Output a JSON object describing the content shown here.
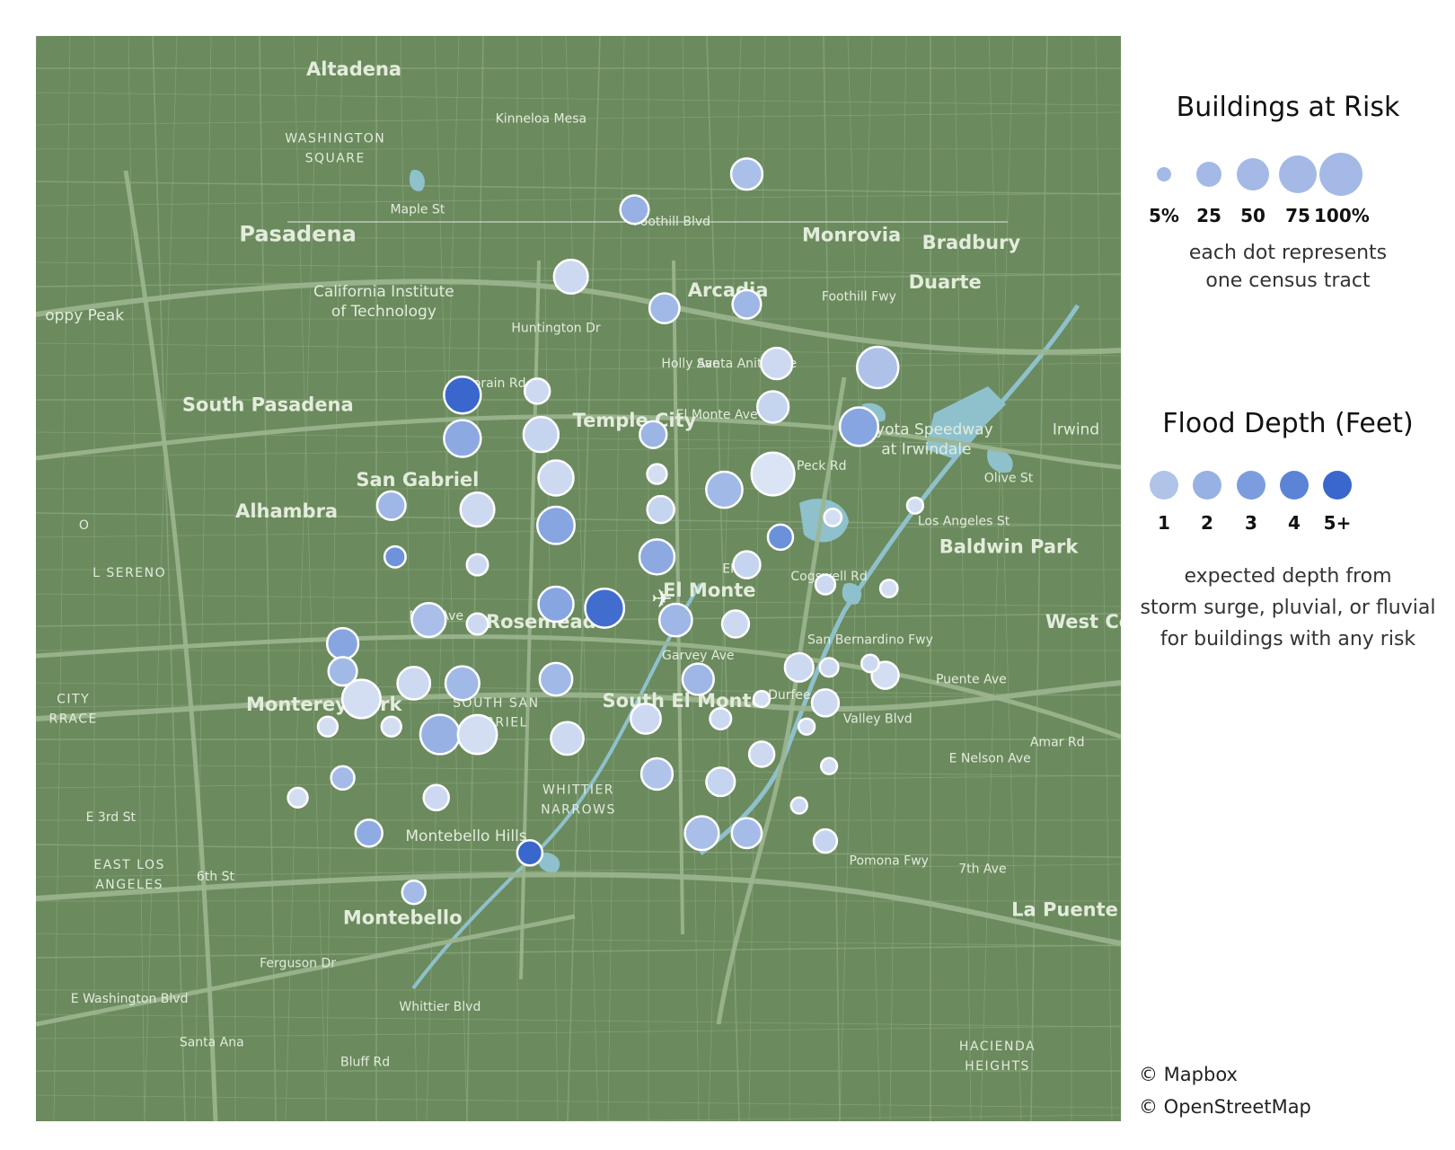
{
  "map": {
    "colors": {
      "land": "#6b8a5e",
      "road": "#8aa67d",
      "major_road": "#9cb58f",
      "water": "#8fc1cc",
      "label": "#e3ecdc",
      "dot_stroke": "#ffffff"
    },
    "places": [
      {
        "name": "Altadena",
        "lon": -118.135,
        "lat": 34.19,
        "size": "l"
      },
      {
        "name": "Kinneloa Mesa",
        "lon": -118.085,
        "lat": 34.178,
        "size": "s"
      },
      {
        "name": "WASHINGTON",
        "lon": -118.14,
        "lat": 34.173,
        "size": "caps"
      },
      {
        "name": "SQUARE",
        "lon": -118.14,
        "lat": 34.168,
        "size": "caps"
      },
      {
        "name": "Maple St",
        "lon": -118.118,
        "lat": 34.155,
        "size": "s"
      },
      {
        "name": "Foothill Blvd",
        "lon": -118.05,
        "lat": 34.152,
        "size": "s"
      },
      {
        "name": "Pasadena",
        "lon": -118.15,
        "lat": 34.148,
        "size": "xl"
      },
      {
        "name": "Monrovia",
        "lon": -118.002,
        "lat": 34.148,
        "size": "l"
      },
      {
        "name": "Bradbury",
        "lon": -117.97,
        "lat": 34.146,
        "size": "l"
      },
      {
        "name": "Duarte",
        "lon": -117.977,
        "lat": 34.136,
        "size": "l"
      },
      {
        "name": "Arcadia",
        "lon": -118.035,
        "lat": 34.134,
        "size": "l"
      },
      {
        "name": "Foothill Fwy",
        "lon": -118.0,
        "lat": 34.133,
        "size": "s"
      },
      {
        "name": "California Institute",
        "lon": -118.127,
        "lat": 34.134,
        "size": "m"
      },
      {
        "name": "of Technology",
        "lon": -118.127,
        "lat": 34.129,
        "size": "m"
      },
      {
        "name": "oppy Peak",
        "lon": -118.207,
        "lat": 34.128,
        "size": "m"
      },
      {
        "name": "Huntington Dr",
        "lon": -118.081,
        "lat": 34.125,
        "size": "s"
      },
      {
        "name": "Holly Ave",
        "lon": -118.045,
        "lat": 34.116,
        "size": "s"
      },
      {
        "name": "Santa Anita Ave",
        "lon": -118.03,
        "lat": 34.116,
        "size": "s"
      },
      {
        "name": "Lorain Rd",
        "lon": -118.097,
        "lat": 34.111,
        "size": "s"
      },
      {
        "name": "South Pasadena",
        "lon": -118.158,
        "lat": 34.105,
        "size": "l"
      },
      {
        "name": "El Monte Ave",
        "lon": -118.038,
        "lat": 34.103,
        "size": "s"
      },
      {
        "name": "Temple City",
        "lon": -118.06,
        "lat": 34.101,
        "size": "l"
      },
      {
        "name": "Toyota Speedway",
        "lon": -117.982,
        "lat": 34.099,
        "size": "m"
      },
      {
        "name": "at Irwindale",
        "lon": -117.982,
        "lat": 34.094,
        "size": "m"
      },
      {
        "name": "Irwind",
        "lon": -117.942,
        "lat": 34.099,
        "size": "m"
      },
      {
        "name": "Peck Rd",
        "lon": -118.01,
        "lat": 34.09,
        "size": "s"
      },
      {
        "name": "San Gabriel",
        "lon": -118.118,
        "lat": 34.086,
        "size": "l"
      },
      {
        "name": "Olive St",
        "lon": -117.96,
        "lat": 34.087,
        "size": "s"
      },
      {
        "name": "Alhambra",
        "lon": -118.153,
        "lat": 34.078,
        "size": "l"
      },
      {
        "name": "Los Angeles St",
        "lon": -117.972,
        "lat": 34.076,
        "size": "s"
      },
      {
        "name": "O",
        "lon": -118.207,
        "lat": 34.075,
        "size": "caps"
      },
      {
        "name": "Baldwin Park",
        "lon": -117.96,
        "lat": 34.069,
        "size": "l"
      },
      {
        "name": "EMT",
        "lon": -118.033,
        "lat": 34.064,
        "size": "s"
      },
      {
        "name": "L SERENO",
        "lon": -118.195,
        "lat": 34.063,
        "size": "caps"
      },
      {
        "name": "El Monte",
        "lon": -118.04,
        "lat": 34.058,
        "size": "l"
      },
      {
        "name": "Cogswell Rd",
        "lon": -118.008,
        "lat": 34.062,
        "size": "s"
      },
      {
        "name": "New Ave",
        "lon": -118.113,
        "lat": 34.052,
        "size": "s"
      },
      {
        "name": "Rosemead",
        "lon": -118.085,
        "lat": 34.05,
        "size": "l"
      },
      {
        "name": "West Cov",
        "lon": -117.937,
        "lat": 34.05,
        "size": "l"
      },
      {
        "name": "San Bernardino Fwy",
        "lon": -117.997,
        "lat": 34.046,
        "size": "s"
      },
      {
        "name": "Garvey Ave",
        "lon": -118.043,
        "lat": 34.042,
        "size": "s"
      },
      {
        "name": "Puente Ave",
        "lon": -117.97,
        "lat": 34.036,
        "size": "s"
      },
      {
        "name": "Durfee Ave",
        "lon": -118.015,
        "lat": 34.032,
        "size": "s"
      },
      {
        "name": "CITY",
        "lon": -118.21,
        "lat": 34.031,
        "size": "caps"
      },
      {
        "name": "RRACE",
        "lon": -118.21,
        "lat": 34.026,
        "size": "caps"
      },
      {
        "name": "Monterey Park",
        "lon": -118.143,
        "lat": 34.029,
        "size": "l"
      },
      {
        "name": "SOUTH SAN",
        "lon": -118.097,
        "lat": 34.03,
        "size": "caps"
      },
      {
        "name": "GABRIEL",
        "lon": -118.097,
        "lat": 34.025,
        "size": "caps"
      },
      {
        "name": "South El Monte",
        "lon": -118.047,
        "lat": 34.03,
        "size": "l"
      },
      {
        "name": "Valley Blvd",
        "lon": -117.995,
        "lat": 34.026,
        "size": "s"
      },
      {
        "name": "Amar Rd",
        "lon": -117.947,
        "lat": 34.02,
        "size": "s"
      },
      {
        "name": "E Nelson Ave",
        "lon": -117.965,
        "lat": 34.016,
        "size": "s"
      },
      {
        "name": "WHITTIER",
        "lon": -118.075,
        "lat": 34.008,
        "size": "caps"
      },
      {
        "name": "NARROWS",
        "lon": -118.075,
        "lat": 34.003,
        "size": "caps"
      },
      {
        "name": "E 3rd St",
        "lon": -118.2,
        "lat": 34.001,
        "size": "s"
      },
      {
        "name": "Montebello Hills",
        "lon": -118.105,
        "lat": 33.996,
        "size": "m"
      },
      {
        "name": "Pomona Fwy",
        "lon": -117.992,
        "lat": 33.99,
        "size": "s"
      },
      {
        "name": "7th Ave",
        "lon": -117.967,
        "lat": 33.988,
        "size": "s"
      },
      {
        "name": "EAST LOS",
        "lon": -118.195,
        "lat": 33.989,
        "size": "caps"
      },
      {
        "name": "ANGELES",
        "lon": -118.195,
        "lat": 33.984,
        "size": "caps"
      },
      {
        "name": "6th St",
        "lon": -118.172,
        "lat": 33.986,
        "size": "s"
      },
      {
        "name": "La Puente",
        "lon": -117.945,
        "lat": 33.977,
        "size": "l"
      },
      {
        "name": "Montebello",
        "lon": -118.122,
        "lat": 33.975,
        "size": "l"
      },
      {
        "name": "Ferguson Dr",
        "lon": -118.15,
        "lat": 33.964,
        "size": "s"
      },
      {
        "name": "E Washington Blvd",
        "lon": -118.195,
        "lat": 33.955,
        "size": "s"
      },
      {
        "name": "Whittier Blvd",
        "lon": -118.112,
        "lat": 33.953,
        "size": "s"
      },
      {
        "name": "Santa Ana",
        "lon": -118.173,
        "lat": 33.944,
        "size": "s"
      },
      {
        "name": "Bluff Rd",
        "lon": -118.132,
        "lat": 33.939,
        "size": "s"
      },
      {
        "name": "HACIENDA",
        "lon": -117.963,
        "lat": 33.943,
        "size": "caps"
      },
      {
        "name": "HEIGHTS",
        "lon": -117.963,
        "lat": 33.938,
        "size": "caps"
      }
    ],
    "tracts": [
      {
        "lon": -118.03,
        "lat": 34.165,
        "risk_pct": 45,
        "depth_ft": 1.2
      },
      {
        "lon": -118.06,
        "lat": 34.156,
        "risk_pct": 35,
        "depth_ft": 2.0
      },
      {
        "lon": -118.077,
        "lat": 34.139,
        "risk_pct": 55,
        "depth_ft": 0.6
      },
      {
        "lon": -118.052,
        "lat": 34.131,
        "risk_pct": 40,
        "depth_ft": 1.6
      },
      {
        "lon": -118.03,
        "lat": 34.132,
        "risk_pct": 35,
        "depth_ft": 1.7
      },
      {
        "lon": -118.022,
        "lat": 34.117,
        "risk_pct": 45,
        "depth_ft": 0.6
      },
      {
        "lon": -117.995,
        "lat": 34.116,
        "risk_pct": 90,
        "depth_ft": 1.1
      },
      {
        "lon": -118.106,
        "lat": 34.109,
        "risk_pct": 68,
        "depth_ft": 5.5
      },
      {
        "lon": -118.086,
        "lat": 34.11,
        "risk_pct": 25,
        "depth_ft": 0.6
      },
      {
        "lon": -118.023,
        "lat": 34.106,
        "risk_pct": 45,
        "depth_ft": 0.7
      },
      {
        "lon": -118.0,
        "lat": 34.101,
        "risk_pct": 75,
        "depth_ft": 2.6
      },
      {
        "lon": -118.106,
        "lat": 34.098,
        "risk_pct": 68,
        "depth_ft": 2.4
      },
      {
        "lon": -118.085,
        "lat": 34.099,
        "risk_pct": 60,
        "depth_ft": 0.7
      },
      {
        "lon": -118.055,
        "lat": 34.099,
        "risk_pct": 30,
        "depth_ft": 1.8
      },
      {
        "lon": -118.081,
        "lat": 34.088,
        "risk_pct": 60,
        "depth_ft": 0.6
      },
      {
        "lon": -118.054,
        "lat": 34.089,
        "risk_pct": 12,
        "depth_ft": 0.5
      },
      {
        "lon": -118.023,
        "lat": 34.089,
        "risk_pct": 98,
        "depth_ft": 0.4
      },
      {
        "lon": -118.036,
        "lat": 34.085,
        "risk_pct": 65,
        "depth_ft": 1.6
      },
      {
        "lon": -118.125,
        "lat": 34.081,
        "risk_pct": 35,
        "depth_ft": 1.7
      },
      {
        "lon": -118.102,
        "lat": 34.08,
        "risk_pct": 55,
        "depth_ft": 0.6
      },
      {
        "lon": -118.081,
        "lat": 34.076,
        "risk_pct": 70,
        "depth_ft": 2.6
      },
      {
        "lon": -118.053,
        "lat": 34.08,
        "risk_pct": 30,
        "depth_ft": 0.7
      },
      {
        "lon": -118.007,
        "lat": 34.078,
        "risk_pct": 8,
        "depth_ft": 0.5
      },
      {
        "lon": -117.985,
        "lat": 34.081,
        "risk_pct": 6,
        "depth_ft": 0.5
      },
      {
        "lon": -118.021,
        "lat": 34.073,
        "risk_pct": 25,
        "depth_ft": 3.5
      },
      {
        "lon": -118.124,
        "lat": 34.068,
        "risk_pct": 15,
        "depth_ft": 3.4
      },
      {
        "lon": -118.102,
        "lat": 34.066,
        "risk_pct": 15,
        "depth_ft": 0.6
      },
      {
        "lon": -118.054,
        "lat": 34.068,
        "risk_pct": 60,
        "depth_ft": 2.4
      },
      {
        "lon": -118.03,
        "lat": 34.066,
        "risk_pct": 30,
        "depth_ft": 0.7
      },
      {
        "lon": -118.009,
        "lat": 34.061,
        "risk_pct": 12,
        "depth_ft": 0.6
      },
      {
        "lon": -117.992,
        "lat": 34.06,
        "risk_pct": 8,
        "depth_ft": 0.5
      },
      {
        "lon": -118.068,
        "lat": 34.055,
        "risk_pct": 78,
        "depth_ft": 4.8
      },
      {
        "lon": -118.081,
        "lat": 34.056,
        "risk_pct": 60,
        "depth_ft": 2.6
      },
      {
        "lon": -118.049,
        "lat": 34.052,
        "risk_pct": 50,
        "depth_ft": 1.7
      },
      {
        "lon": -118.115,
        "lat": 34.052,
        "risk_pct": 55,
        "depth_ft": 1.3
      },
      {
        "lon": -118.102,
        "lat": 34.051,
        "risk_pct": 15,
        "depth_ft": 0.6
      },
      {
        "lon": -118.033,
        "lat": 34.051,
        "risk_pct": 30,
        "depth_ft": 0.6
      },
      {
        "lon": -118.138,
        "lat": 34.046,
        "risk_pct": 45,
        "depth_ft": 2.6
      },
      {
        "lon": -118.138,
        "lat": 34.039,
        "risk_pct": 35,
        "depth_ft": 1.6
      },
      {
        "lon": -118.016,
        "lat": 34.04,
        "risk_pct": 35,
        "depth_ft": 0.6
      },
      {
        "lon": -118.008,
        "lat": 34.04,
        "risk_pct": 10,
        "depth_ft": 0.6
      },
      {
        "lon": -117.997,
        "lat": 34.041,
        "risk_pct": 8,
        "depth_ft": 0.6
      },
      {
        "lon": -117.993,
        "lat": 34.038,
        "risk_pct": 30,
        "depth_ft": 0.5
      },
      {
        "lon": -118.119,
        "lat": 34.036,
        "risk_pct": 50,
        "depth_ft": 0.6
      },
      {
        "lon": -118.106,
        "lat": 34.036,
        "risk_pct": 55,
        "depth_ft": 1.6
      },
      {
        "lon": -118.081,
        "lat": 34.037,
        "risk_pct": 50,
        "depth_ft": 1.6
      },
      {
        "lon": -118.043,
        "lat": 34.037,
        "risk_pct": 45,
        "depth_ft": 1.7
      },
      {
        "lon": -118.133,
        "lat": 34.032,
        "risk_pct": 75,
        "depth_ft": 0.5
      },
      {
        "lon": -118.026,
        "lat": 34.032,
        "risk_pct": 6,
        "depth_ft": 0.5
      },
      {
        "lon": -118.009,
        "lat": 34.031,
        "risk_pct": 30,
        "depth_ft": 0.6
      },
      {
        "lon": -118.057,
        "lat": 34.027,
        "risk_pct": 40,
        "depth_ft": 0.6
      },
      {
        "lon": -118.037,
        "lat": 34.027,
        "risk_pct": 15,
        "depth_ft": 0.6
      },
      {
        "lon": -118.142,
        "lat": 34.025,
        "risk_pct": 12,
        "depth_ft": 0.5
      },
      {
        "lon": -118.125,
        "lat": 34.025,
        "risk_pct": 12,
        "depth_ft": 0.5
      },
      {
        "lon": -118.112,
        "lat": 34.023,
        "risk_pct": 80,
        "depth_ft": 2.0
      },
      {
        "lon": -118.102,
        "lat": 34.023,
        "risk_pct": 78,
        "depth_ft": 0.5
      },
      {
        "lon": -118.078,
        "lat": 34.022,
        "risk_pct": 50,
        "depth_ft": 0.6
      },
      {
        "lon": -118.014,
        "lat": 34.025,
        "risk_pct": 6,
        "depth_ft": 0.5
      },
      {
        "lon": -118.026,
        "lat": 34.018,
        "risk_pct": 25,
        "depth_ft": 0.6
      },
      {
        "lon": -118.008,
        "lat": 34.015,
        "risk_pct": 6,
        "depth_ft": 0.5
      },
      {
        "lon": -118.138,
        "lat": 34.012,
        "risk_pct": 20,
        "depth_ft": 1.5
      },
      {
        "lon": -118.15,
        "lat": 34.007,
        "risk_pct": 12,
        "depth_ft": 0.5
      },
      {
        "lon": -118.054,
        "lat": 34.013,
        "risk_pct": 45,
        "depth_ft": 1.0
      },
      {
        "lon": -118.037,
        "lat": 34.011,
        "risk_pct": 35,
        "depth_ft": 0.7
      },
      {
        "lon": -118.113,
        "lat": 34.007,
        "risk_pct": 25,
        "depth_ft": 0.6
      },
      {
        "lon": -118.016,
        "lat": 34.005,
        "risk_pct": 6,
        "depth_ft": 0.6
      },
      {
        "lon": -118.131,
        "lat": 33.998,
        "risk_pct": 30,
        "depth_ft": 2.3
      },
      {
        "lon": -118.042,
        "lat": 33.998,
        "risk_pct": 55,
        "depth_ft": 1.3
      },
      {
        "lon": -118.03,
        "lat": 33.998,
        "risk_pct": 40,
        "depth_ft": 1.4
      },
      {
        "lon": -118.009,
        "lat": 33.996,
        "risk_pct": 20,
        "depth_ft": 0.7
      },
      {
        "lon": -118.088,
        "lat": 33.993,
        "risk_pct": 25,
        "depth_ft": 5.0
      },
      {
        "lon": -118.119,
        "lat": 33.983,
        "risk_pct": 20,
        "depth_ft": 1.5
      }
    ]
  },
  "legend": {
    "size_title": "Buildings at Risk",
    "size_items": [
      {
        "label": "5%",
        "pct": 5
      },
      {
        "label": "25",
        "pct": 25
      },
      {
        "label": "50",
        "pct": 50
      },
      {
        "label": "75",
        "pct": 75
      },
      {
        "label": "100%",
        "pct": 100
      }
    ],
    "size_note_1": "each dot represents",
    "size_note_2": "one census tract",
    "depth_title": "Flood Depth (Feet)",
    "depth_items": [
      {
        "label": "1",
        "color": "#b0c4ea"
      },
      {
        "label": "2",
        "color": "#97b1e4"
      },
      {
        "label": "3",
        "color": "#7b9ddf"
      },
      {
        "label": "4",
        "color": "#5b84d6"
      },
      {
        "label": "5+",
        "color": "#3a67cc"
      }
    ],
    "depth_note_1": "expected depth from",
    "depth_note_2": "storm surge, pluvial, or fluvial",
    "depth_note_3": "for buildings with any risk"
  },
  "attribution": {
    "line1": "© Mapbox",
    "line2": "© OpenStreetMap"
  }
}
